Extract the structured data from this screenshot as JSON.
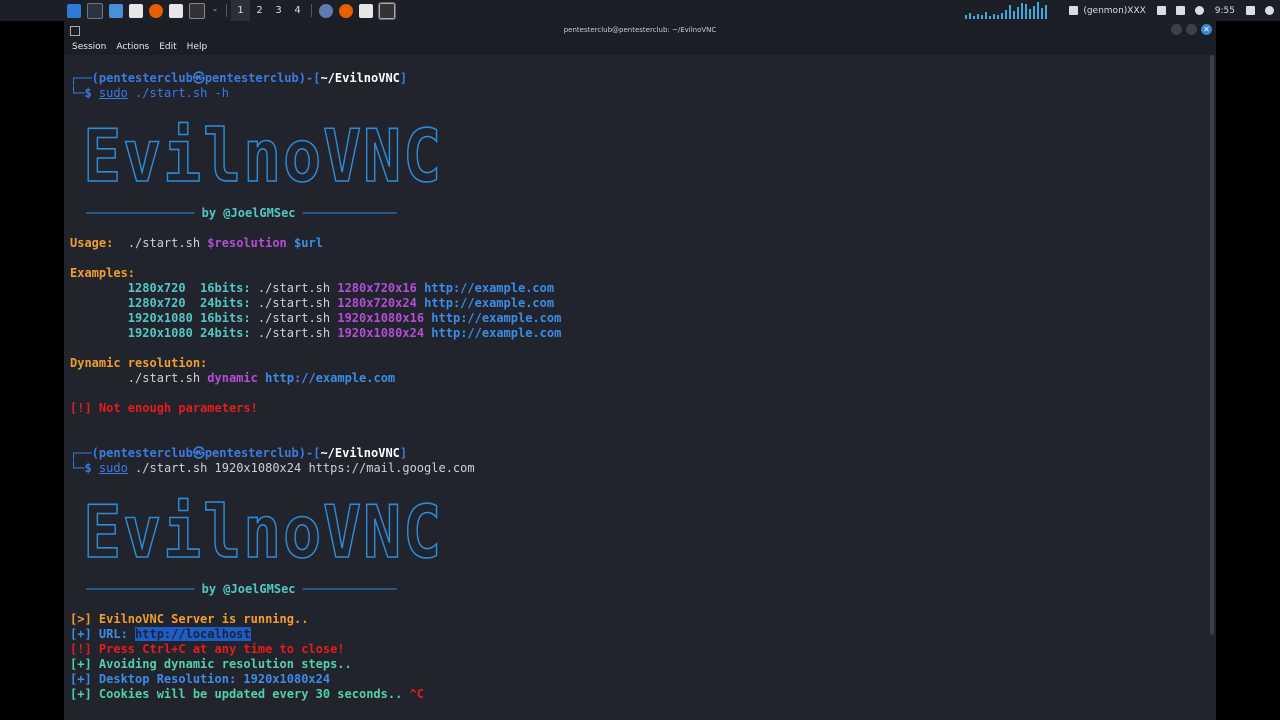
{
  "panel": {
    "workspaces": [
      "1",
      "2",
      "3",
      "4"
    ],
    "genmon": "(genmon)XXX",
    "clock": "9:55"
  },
  "window": {
    "title": "pentesterclub@pentesterclub: ~/EvilnoVNC",
    "menu": [
      "Session",
      "Actions",
      "Edit",
      "Help"
    ]
  },
  "terminal": {
    "prompt": {
      "user_host": "pentesterclub㉿pentesterclub",
      "path": "~/EvilnoVNC"
    },
    "cmd1": {
      "sudo": "sudo",
      "rest": "./start.sh -h"
    },
    "banner_title": "EvilnoVNC",
    "byline": "by @JoelGMSec",
    "usage": {
      "label": "Usage:",
      "cmd": "./start.sh",
      "arg1": "$resolution",
      "arg2": "$url"
    },
    "examples_label": "Examples:",
    "examples": [
      {
        "res": "1280x720",
        "bits": "16bits:",
        "cmd": "./start.sh",
        "arg": "1280x720x16",
        "url": "http://example.com"
      },
      {
        "res": "1280x720",
        "bits": "24bits:",
        "cmd": "./start.sh",
        "arg": "1280x720x24",
        "url": "http://example.com"
      },
      {
        "res": "1920x1080",
        "bits": "16bits:",
        "cmd": "./start.sh",
        "arg": "1920x1080x16",
        "url": "http://example.com"
      },
      {
        "res": "1920x1080",
        "bits": "24bits:",
        "cmd": "./start.sh",
        "arg": "1920x1080x24",
        "url": "http://example.com"
      }
    ],
    "dynamic": {
      "label": "Dynamic resolution:",
      "cmd": "./start.sh",
      "arg": "dynamic",
      "url": "http://example.com"
    },
    "error1": "[!] Not enough parameters!",
    "cmd2": {
      "sudo": "sudo",
      "rest": "./start.sh 1920x1080x24 https://mail.google.com"
    },
    "status": {
      "running": "[>] EvilnoVNC Server is running..",
      "url_label": "[+] URL: ",
      "url_value": "http://localhost",
      "ctrlc": "[!] Press Ctrl+C at any time to close!",
      "avoid": "[+] Avoiding dynamic resolution steps..",
      "desktop": "[+] Desktop Resolution: 1920x1080x24",
      "cookies": "[+] Cookies will be updated every 30 seconds..",
      "interrupt": "^C"
    }
  },
  "colors": {
    "panel_bg": "#1c1f26",
    "terminal_bg": "#21242c",
    "prompt_blue": "#3c7be0",
    "orange": "#f09e2d",
    "purple": "#b24fd6",
    "red": "#e51c1c",
    "cyan": "#53c7c7"
  }
}
